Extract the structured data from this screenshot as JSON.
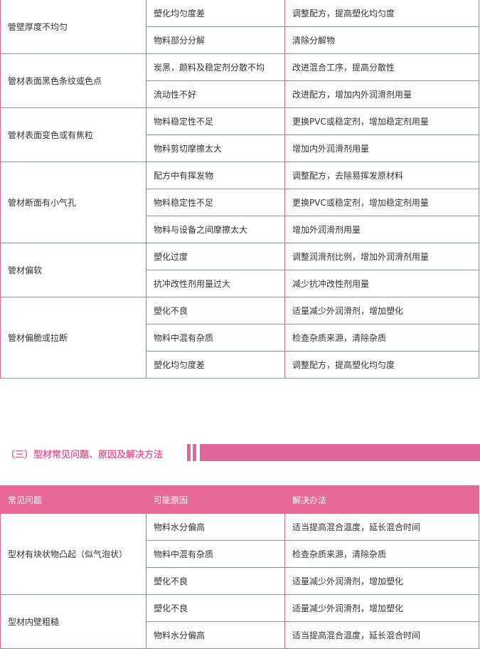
{
  "table_top": {
    "groups": [
      {
        "problem": "管壁厚度不均匀",
        "rows": [
          {
            "cause": "塑化均匀度差",
            "solution": "调整配方，提高塑化均匀度"
          },
          {
            "cause": "物料部分分解",
            "solution": "清除分解物"
          }
        ]
      },
      {
        "problem": "管材表面黑色条纹或色点",
        "rows": [
          {
            "cause": "炭黑，颜料及稳定剂分散不均",
            "solution": "改进混合工序，提高分散性"
          },
          {
            "cause": "流动性不好",
            "solution": "改进配方，增加内外润滑剂用量"
          }
        ]
      },
      {
        "problem": "管材表面变色或有焦粒",
        "rows": [
          {
            "cause": "物料稳定性不足",
            "solution": "更换PVC或稳定剂，增加稳定剂用量"
          },
          {
            "cause": "物料剪切摩擦太大",
            "solution": "增加内外润滑剂用量"
          }
        ]
      },
      {
        "problem": "管材断面有小气孔",
        "rows": [
          {
            "cause": "配方中有挥发物",
            "solution": "调整配方，去除易挥发原材料"
          },
          {
            "cause": "物料稳定性不足",
            "solution": "更换PVC或稳定剂，增加稳定剂用量"
          },
          {
            "cause": "物料与设备之间摩擦太大",
            "solution": "增加外润滑剂用量"
          }
        ]
      },
      {
        "problem": "管材偏软",
        "rows": [
          {
            "cause": "塑化过度",
            "solution": "调整润滑剂比例，增加外润滑剂用量"
          },
          {
            "cause": "抗冲改性剂用量过大",
            "solution": "减少抗冲改性剂用量"
          }
        ]
      },
      {
        "problem": "管材偏脆或拉断",
        "rows": [
          {
            "cause": "塑化不良",
            "solution": "适量减少外润滑剂，增加塑化"
          },
          {
            "cause": "物料中混有杂质",
            "solution": "检查杂质来源，清除杂质"
          },
          {
            "cause": "塑化均匀度差",
            "solution": "调整配方，提高塑化均匀度"
          }
        ]
      }
    ]
  },
  "section": {
    "title": "（三）型材常见问题、原因及解决方法"
  },
  "table_bottom": {
    "headers": {
      "problem": "常见问题",
      "cause": "可能原因",
      "solution": "解决办法"
    },
    "groups": [
      {
        "problem": "型材有块状物凸起（似气泡状）",
        "rows": [
          {
            "cause": "物料水分偏高",
            "solution": "适当提高混合温度，延长混合时间"
          },
          {
            "cause": "物料中混有杂质",
            "solution": "检查杂质来源，清除杂质"
          },
          {
            "cause": "塑化不良",
            "solution": "适量减少外润滑剂，增加塑化"
          }
        ]
      },
      {
        "problem": "型材内壁粗糙",
        "rows": [
          {
            "cause": "塑化不良",
            "solution": "适量减少外润滑剂，增加塑化"
          },
          {
            "cause": "物料水分偏高",
            "solution": "适当提高混合温度，延长混合时间"
          }
        ]
      }
    ]
  },
  "colors": {
    "accent": "#e0659a",
    "header_bg": "#e8689a",
    "text": "#333333"
  }
}
